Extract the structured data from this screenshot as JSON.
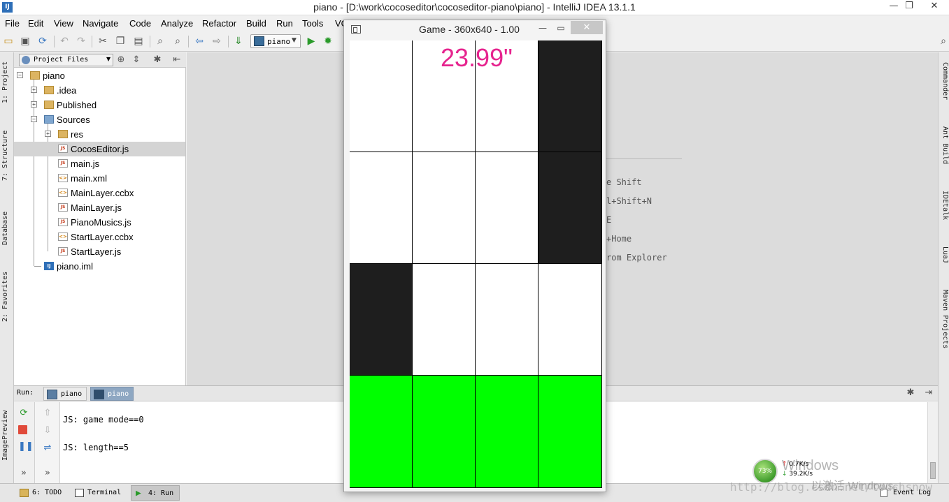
{
  "window": {
    "title": "piano - [D:\\work\\cocoseditor\\cocoseditor-piano\\piano] - IntelliJ IDEA 13.1.1",
    "minimize": "—",
    "maximize": "❐",
    "close": "✕"
  },
  "menu": [
    "File",
    "Edit",
    "View",
    "Navigate",
    "Code",
    "Analyze",
    "Refactor",
    "Build",
    "Run",
    "Tools",
    "VC"
  ],
  "toolbar": {
    "run_config": "piano"
  },
  "left_tool_tabs": [
    "1: Project",
    "7: Structure",
    "Database",
    "2: Favorites",
    "ImagePreview"
  ],
  "right_tool_tabs": [
    "Commander",
    "Ant Build",
    "IDEtalk",
    "LuaJ",
    "Maven Projects"
  ],
  "project": {
    "selector": "Project Files",
    "tree": [
      {
        "label": "piano",
        "type": "folder",
        "level": 0,
        "toggle": "−"
      },
      {
        "label": ".idea",
        "type": "folder",
        "level": 1,
        "toggle": "+"
      },
      {
        "label": "Published",
        "type": "folder",
        "level": 1,
        "toggle": "+"
      },
      {
        "label": "Sources",
        "type": "folder-blue",
        "level": 1,
        "toggle": "−"
      },
      {
        "label": "res",
        "type": "folder",
        "level": 2,
        "toggle": "+"
      },
      {
        "label": "CocosEditor.js",
        "type": "js",
        "level": 2,
        "selected": true
      },
      {
        "label": "main.js",
        "type": "js",
        "level": 2
      },
      {
        "label": "main.xml",
        "type": "xml",
        "level": 2
      },
      {
        "label": "MainLayer.ccbx",
        "type": "xml",
        "level": 2
      },
      {
        "label": "MainLayer.js",
        "type": "js",
        "level": 2
      },
      {
        "label": "PianoMusics.js",
        "type": "js",
        "level": 2
      },
      {
        "label": "StartLayer.ccbx",
        "type": "xml",
        "level": 2
      },
      {
        "label": "StartLayer.js",
        "type": "js",
        "level": 2
      },
      {
        "label": "piano.iml",
        "type": "iml",
        "level": 1
      }
    ]
  },
  "editor_hints": [
    "e Shift",
    "l+Shift+N",
    "E",
    "+Home",
    "rom Explorer"
  ],
  "run_panel": {
    "label": "Run:",
    "tabs": [
      "piano",
      "piano"
    ],
    "console": [
      "JS: game mode==0",
      "JS: length==5"
    ]
  },
  "status_tabs": [
    {
      "label": "6: TODO"
    },
    {
      "label": "Terminal"
    },
    {
      "label": "4: Run",
      "active": true
    },
    {
      "label": "Event Log"
    }
  ],
  "game": {
    "title": "Game - 360x640 - 1.00",
    "timer": "23.99\"",
    "rows": [
      [
        "white",
        "white",
        "white",
        "black"
      ],
      [
        "white",
        "white",
        "white",
        "black"
      ],
      [
        "black",
        "white",
        "white",
        "white"
      ],
      [
        "green",
        "green",
        "green",
        "green"
      ]
    ]
  },
  "overlay": {
    "net_percent": "73%",
    "net_up": "0.7K/s",
    "net_down": "39.2K/s",
    "watermark_windows": "Windows",
    "watermark_activate": "以激活 Windows。",
    "watermark_url": "http://blog.csdn.net/touchsnow"
  },
  "colors": {
    "timer": "#e6238e",
    "tile_black": "#1e1e1e",
    "tile_green": "#00ff00"
  }
}
